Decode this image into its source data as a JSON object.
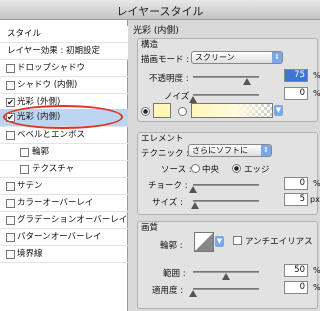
{
  "window": {
    "title": "レイヤースタイル"
  },
  "sidebar": {
    "header_style": "スタイル",
    "header_default": "レイヤー効果 : 初期設定",
    "items": [
      {
        "label": "ドロップシャドウ",
        "checked": false
      },
      {
        "label": "シャドウ (内側)",
        "checked": false
      },
      {
        "label": "光彩 (外側)",
        "checked": true
      },
      {
        "label": "光彩 (内側)",
        "checked": true,
        "selected": true
      },
      {
        "label": "ベベルとエンボス",
        "checked": false
      },
      {
        "label": "輪郭",
        "checked": false
      },
      {
        "label": "テクスチャ",
        "checked": false
      },
      {
        "label": "サテン",
        "checked": false
      },
      {
        "label": "カラーオーバーレイ",
        "checked": false
      },
      {
        "label": "グラデーションオーバーレイ",
        "checked": false
      },
      {
        "label": "パターンオーバーレイ",
        "checked": false
      },
      {
        "label": "境界線",
        "checked": false
      }
    ]
  },
  "panel": {
    "title": "光彩 (内側)",
    "structure": {
      "title": "構造",
      "blend_mode_label": "描画モード :",
      "blend_mode_value": "スクリーン",
      "opacity_label": "不透明度 :",
      "opacity_value": "75",
      "opacity_unit": "%",
      "opacity_level": 0.75,
      "noise_label": "ノイズ :",
      "noise_value": "0",
      "noise_unit": "%",
      "noise_level": 0,
      "glow_color": "#fff7b8"
    },
    "elements": {
      "title": "エレメント",
      "technique_label": "テクニック :",
      "technique_value": "さらにソフトに",
      "source_label": "ソース :",
      "source_center": "中央",
      "source_edge": "エッジ",
      "choke_label": "チョーク :",
      "choke_value": "0",
      "choke_unit": "%",
      "choke_level": 0,
      "size_label": "サイズ :",
      "size_value": "5",
      "size_unit": "px",
      "size_level": 0.02
    },
    "quality": {
      "title": "画質",
      "contour_label": "輪郭 :",
      "antialias_label": "アンチエイリアス",
      "range_label": "範囲 :",
      "range_value": "50",
      "range_unit": "%",
      "range_level": 0.5,
      "jitter_label": "適用度 :",
      "jitter_value": "0",
      "jitter_unit": "%",
      "jitter_level": 0
    }
  }
}
